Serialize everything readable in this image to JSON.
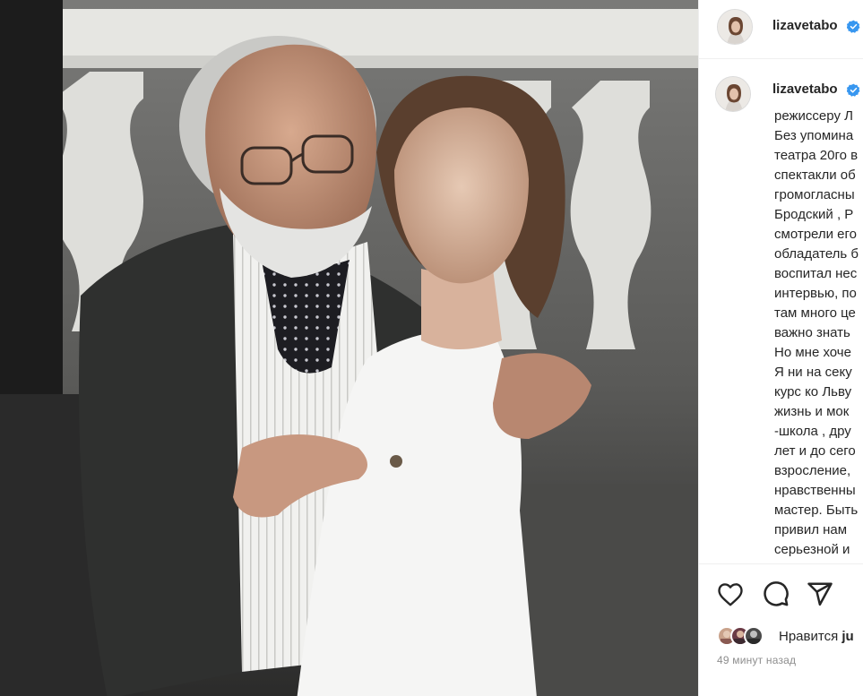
{
  "photo": {
    "icon": "photo-of-man-and-woman-on-stage"
  },
  "header": {
    "username": "lizavetabo",
    "verified_icon": "verified-badge-icon",
    "verified_color": "#3897f0"
  },
  "caption": {
    "username": "lizavetabo",
    "lines": [
      "режиссеру Л",
      "Без упомина",
      "театра 20го в",
      "спектакли об",
      "громогласны",
      "Бродский , Р",
      "смотрели его",
      "обладатель б",
      "воспитал нес",
      "интервью, по",
      "там много це",
      "важно знать",
      "Но мне хоче",
      "Я ни на секу",
      "курс ко Льву",
      "жизнь и мок",
      "-школа , дру",
      "лет и до сего",
      "взросление,",
      "нравственны",
      "мастер. Быть",
      "привил нам",
      "серьезной и"
    ]
  },
  "actions": {
    "like_icon": "heart-icon",
    "comment_icon": "comment-bubble-icon",
    "share_icon": "paper-plane-icon"
  },
  "likes": {
    "prefix": "Нравится ",
    "name": "ju"
  },
  "time_ago": "49 минут назад"
}
